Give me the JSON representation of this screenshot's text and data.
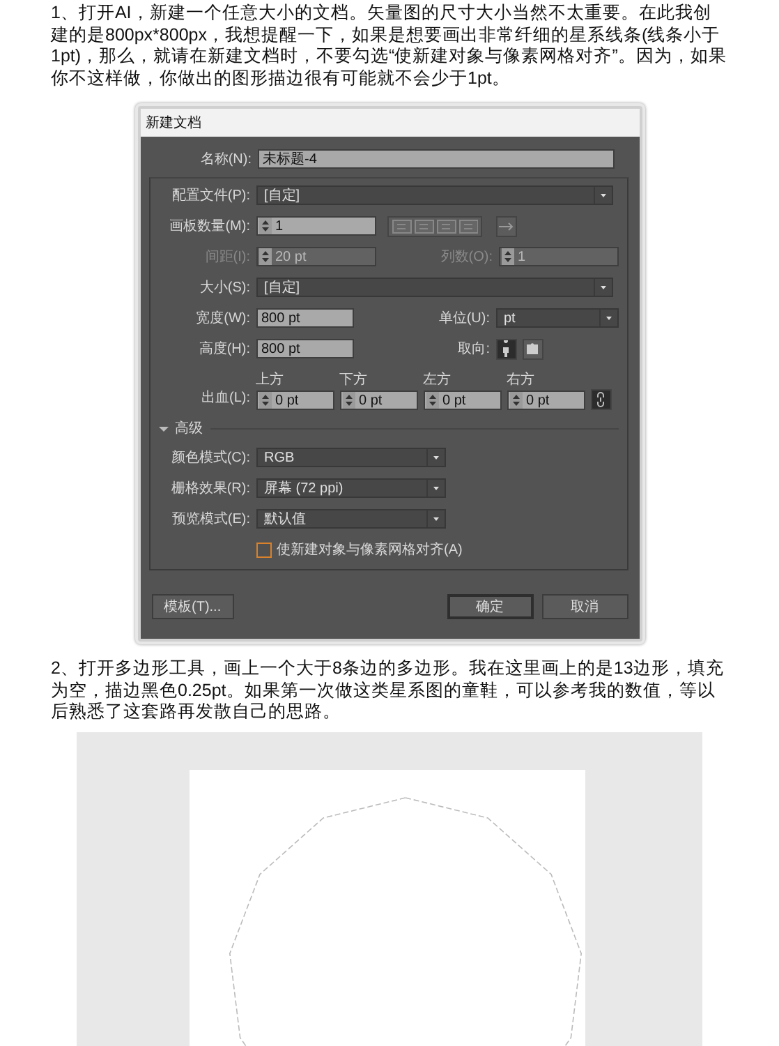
{
  "intro_text": "1、打开AI，新建一个任意大小的文档。矢量图的尺寸大小当然不太重要。在此我创建的是800px*800px，我想提醒一下，如果是想要画出非常纤细的星系线条(线条小于1pt)，那么，就请在新建文档时，不要勾选“使新建对象与像素网格对齐”。因为，如果你不这样做，你做出的图形描边很有可能就不会少于1pt。",
  "dialog": {
    "title": "新建文档",
    "name": {
      "label": "名称(N):",
      "value": "未标题-4"
    },
    "profile": {
      "label": "配置文件(P):",
      "value": "[自定]"
    },
    "artboards": {
      "label": "画板数量(M):",
      "value": "1"
    },
    "spacing": {
      "label": "间距(I):",
      "value": "20 pt",
      "disabled": true
    },
    "columns": {
      "label": "列数(O):",
      "value": "1",
      "disabled": true
    },
    "size": {
      "label": "大小(S):",
      "value": "[自定]"
    },
    "width": {
      "label": "宽度(W):",
      "value": "800 pt"
    },
    "units": {
      "label": "单位(U):",
      "value": "pt"
    },
    "height": {
      "label": "高度(H):",
      "value": "800 pt"
    },
    "orientation": {
      "label": "取向:",
      "options": [
        {
          "kind": "portrait",
          "selected": true
        },
        {
          "kind": "landscape",
          "selected": false
        }
      ]
    },
    "bleed": {
      "label": "出血(L):",
      "sides": [
        {
          "label": "上方",
          "value": "0 pt"
        },
        {
          "label": "下方",
          "value": "0 pt"
        },
        {
          "label": "左方",
          "value": "0 pt"
        },
        {
          "label": "右方",
          "value": "0 pt"
        }
      ]
    },
    "advanced": {
      "label": "高级",
      "expanded": true
    },
    "color_mode": {
      "label": "颜色模式(C):",
      "value": "RGB"
    },
    "raster": {
      "label": "栅格效果(R):",
      "value": "屏幕 (72 ppi)"
    },
    "preview": {
      "label": "预览模式(E):",
      "value": "默认值"
    },
    "align_to_grid": {
      "label": "使新建对象与像素网格对齐(A)",
      "checked": false
    },
    "buttons": [
      {
        "label": "模板(T)...",
        "default": false
      },
      {
        "label": "确定",
        "default": true
      },
      {
        "label": "取消",
        "default": false
      }
    ]
  },
  "step2_text": "2、打开多边形工具，画上一个大于8条边的多边形。我在这里画上的是13边形，填充为空，描边黑色0.25pt。如果第一次做这类星系图的童鞋，可以参考我的数值，等以后熟悉了这套路再发散自己的思路。"
}
